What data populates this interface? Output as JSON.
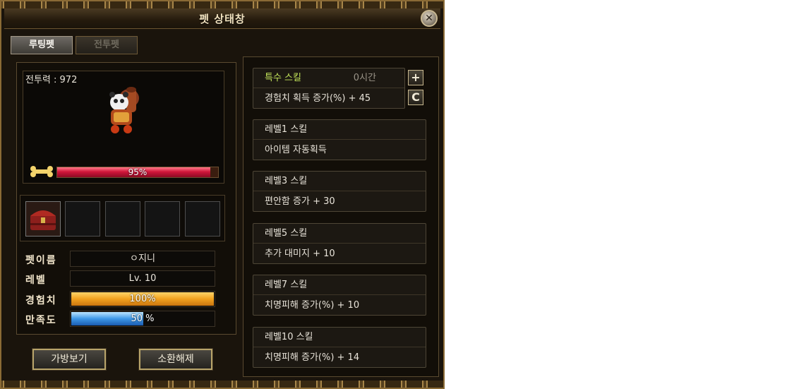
{
  "window": {
    "title": "펫 상태창",
    "close_icon": "close-icon"
  },
  "tabs": [
    {
      "label": "루팅펫",
      "active": true
    },
    {
      "label": "전투펫",
      "active": false
    }
  ],
  "pet": {
    "combat_power": "전투력 : 972",
    "hunger_percent_text": "95%",
    "hunger_fraction": 0.95,
    "slots": [
      "item-chest",
      "",
      "",
      "",
      ""
    ],
    "name_label": "펫이름",
    "name_value": "ㅇ지니",
    "level_label": "레벨",
    "level_value": "Lv. 10",
    "exp_label": "경험치",
    "exp_text": "100%",
    "exp_fraction": 1.0,
    "satisfaction_label": "만족도",
    "satisfaction_num": "50",
    "satisfaction_unit": "%",
    "satisfaction_fraction": 0.5
  },
  "buttons": {
    "bag": "가방보기",
    "dismiss": "소환해제"
  },
  "special_skill": {
    "title": "특수 스킬",
    "time": "0시간",
    "effect": "경험치 획득 증가(%) + 45",
    "plus_icon": "+",
    "refresh_icon": "C"
  },
  "skills": [
    {
      "title": "레벨1 스킬",
      "effect": "아이템 자동획득"
    },
    {
      "title": "레벨3 스킬",
      "effect": "편안함 증가 + 30"
    },
    {
      "title": "레벨5 스킬",
      "effect": "추가 대미지 + 10"
    },
    {
      "title": "레벨7 스킬",
      "effect": "치명피해 증가(%) + 10"
    },
    {
      "title": "레벨10 스킬",
      "effect": "치명피해 증가(%) + 14"
    }
  ],
  "colors": {
    "hp": "#d0163a",
    "exp": "#f2a21e",
    "satisfaction": "#3d97e6",
    "special_title": "#c2e45a"
  }
}
